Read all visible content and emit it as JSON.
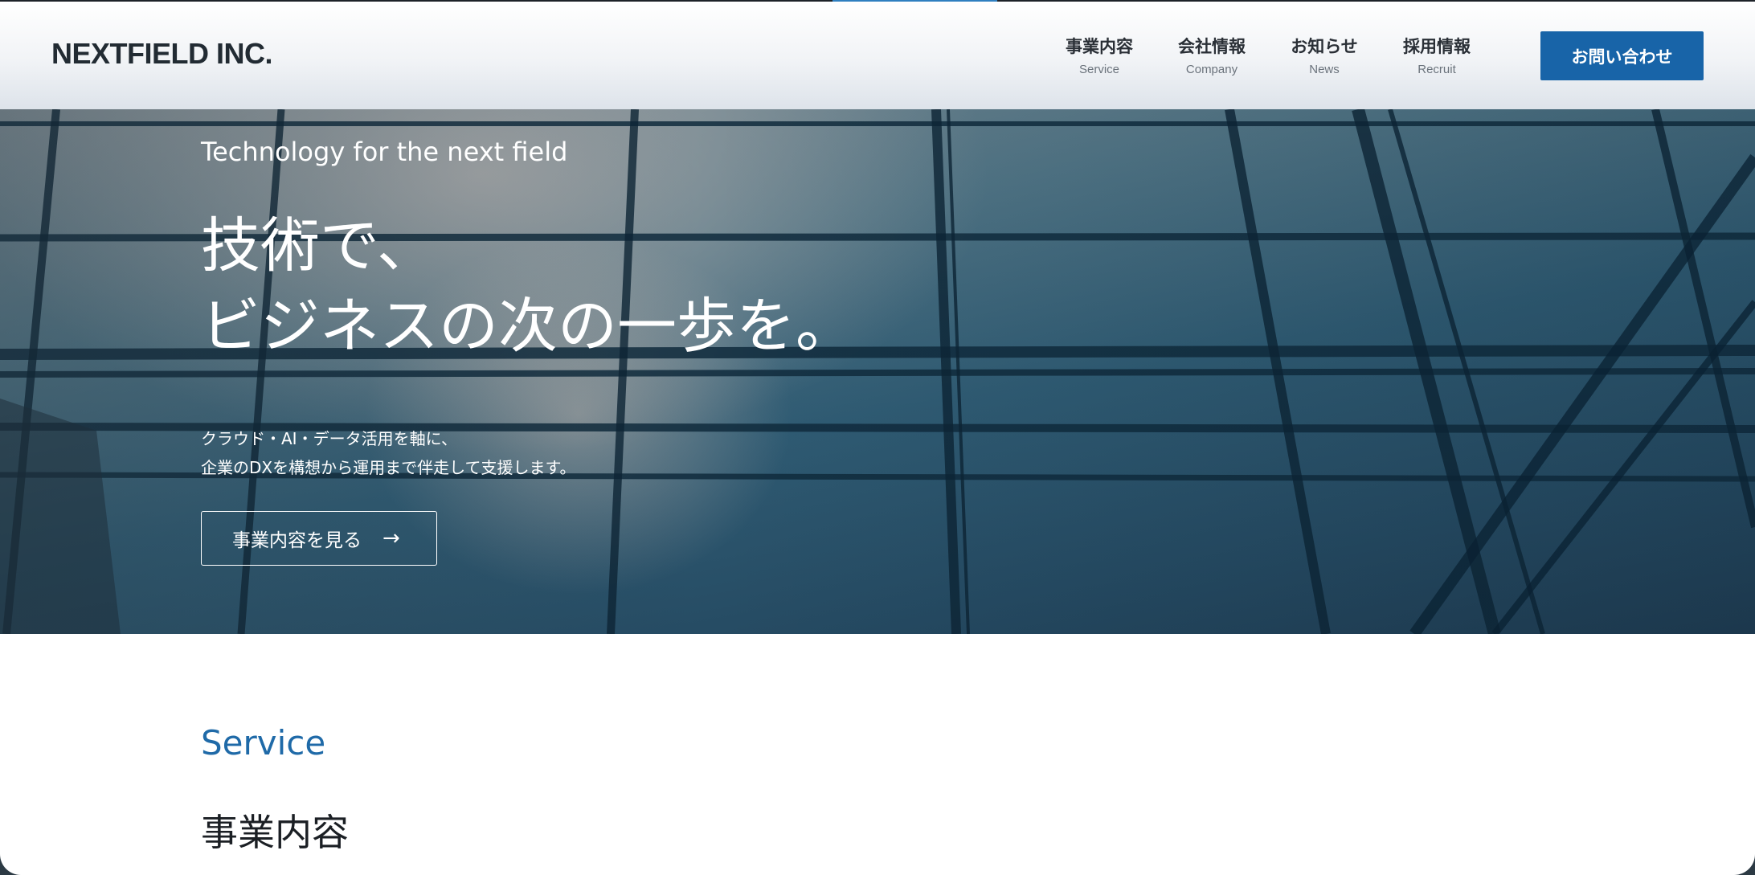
{
  "header": {
    "logo": "NEXTFIELD INC.",
    "nav": [
      {
        "jp": "事業内容",
        "en": "Service"
      },
      {
        "jp": "会社情報",
        "en": "Company"
      },
      {
        "jp": "お知らせ",
        "en": "News"
      },
      {
        "jp": "採用情報",
        "en": "Recruit"
      }
    ],
    "contact_label": "お問い合わせ"
  },
  "hero": {
    "tagline": "Technology for the next field",
    "headline_line1": "技術で、",
    "headline_line2": "ビジネスの次の一歩を。",
    "desc_line1": "クラウド・AI・データ活用を軸に、",
    "desc_line2": "企業のDXを構想から運用まで伴走して支援します。",
    "cta_label": "事業内容を見る",
    "cta_arrow": "→"
  },
  "service": {
    "eyebrow": "Service",
    "title": "事業内容"
  },
  "colors": {
    "accent": "#1864a8",
    "service_heading": "#1f6aa8"
  }
}
